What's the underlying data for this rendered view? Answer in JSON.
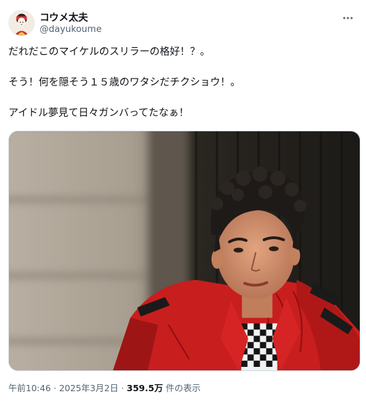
{
  "author": {
    "display_name": "コウメ太夫",
    "handle": "@dayukoume",
    "avatar_icon": "avatar-illustration-icon"
  },
  "more_icon": "more-options-icon",
  "tweet": {
    "lines": [
      "だれだこのマイケルのスリラーの格好！？。",
      "そう！何を隠そう１５歳のワタシだチクショウ！。",
      "アイドル夢見て日々ガンバってたなぁ！"
    ]
  },
  "media": {
    "icon": "photo",
    "colors": {
      "jacket": "#c81e1e",
      "hair": "#1e1a18",
      "wall": "#2a2620"
    }
  },
  "meta": {
    "time": "午前10:46",
    "separator": "·",
    "date": "2025年3月2日",
    "views_count": "359.5万",
    "views_label": "件の表示"
  }
}
